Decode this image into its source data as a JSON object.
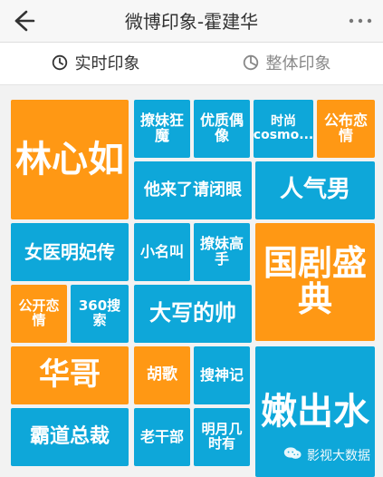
{
  "header": {
    "title": "微博印象-霍建华"
  },
  "tabs": [
    {
      "label": "实时印象",
      "active": true
    },
    {
      "label": "整体印象",
      "active": false
    }
  ],
  "tiles": [
    "林心如",
    "撩妹狂魔",
    "优质偶像",
    "时尚cosmo...",
    "公布恋情",
    "他来了请闭眼",
    "人气男",
    "女医明妃传",
    "小名叫",
    "撩妹高手",
    "国剧盛典",
    "公开恋情",
    "360搜索",
    "大写的帅",
    "华哥",
    "胡歌",
    "搜神记",
    "嫩出水",
    "霸道总裁",
    "老干部",
    "明月几时有"
  ],
  "watermark": {
    "text": "影视大数据"
  },
  "colors": {
    "blue": "#0ea7d9",
    "orange": "#ff9814",
    "accent": "#ff9a14"
  }
}
